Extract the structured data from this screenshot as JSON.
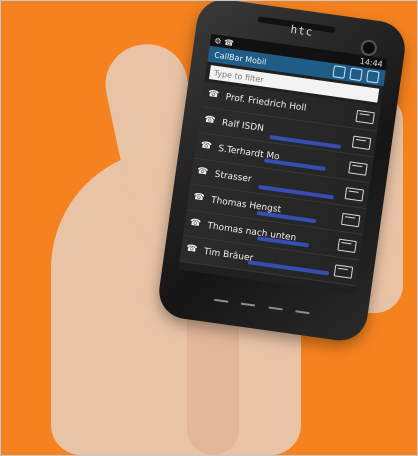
{
  "device": {
    "brand": "htc"
  },
  "status_bar": {
    "time": "14:44"
  },
  "app": {
    "title": "CallBar Mobil"
  },
  "filter": {
    "placeholder": "Type to filter"
  },
  "contacts": [
    {
      "name": "Prof. Friedrich Holl"
    },
    {
      "name": "Ralf ISDN"
    },
    {
      "name": "S.Terhardt Mo"
    },
    {
      "name": "Strasser"
    },
    {
      "name": "Thomas Hengst"
    },
    {
      "name": "Thomas nach unten"
    },
    {
      "name": "Tim Bräuer"
    }
  ],
  "colors": {
    "background": "#f5821f",
    "title_bar": "#1f5c86",
    "skin": "#e9c3a6",
    "phone_body": "#1a1a1a"
  }
}
